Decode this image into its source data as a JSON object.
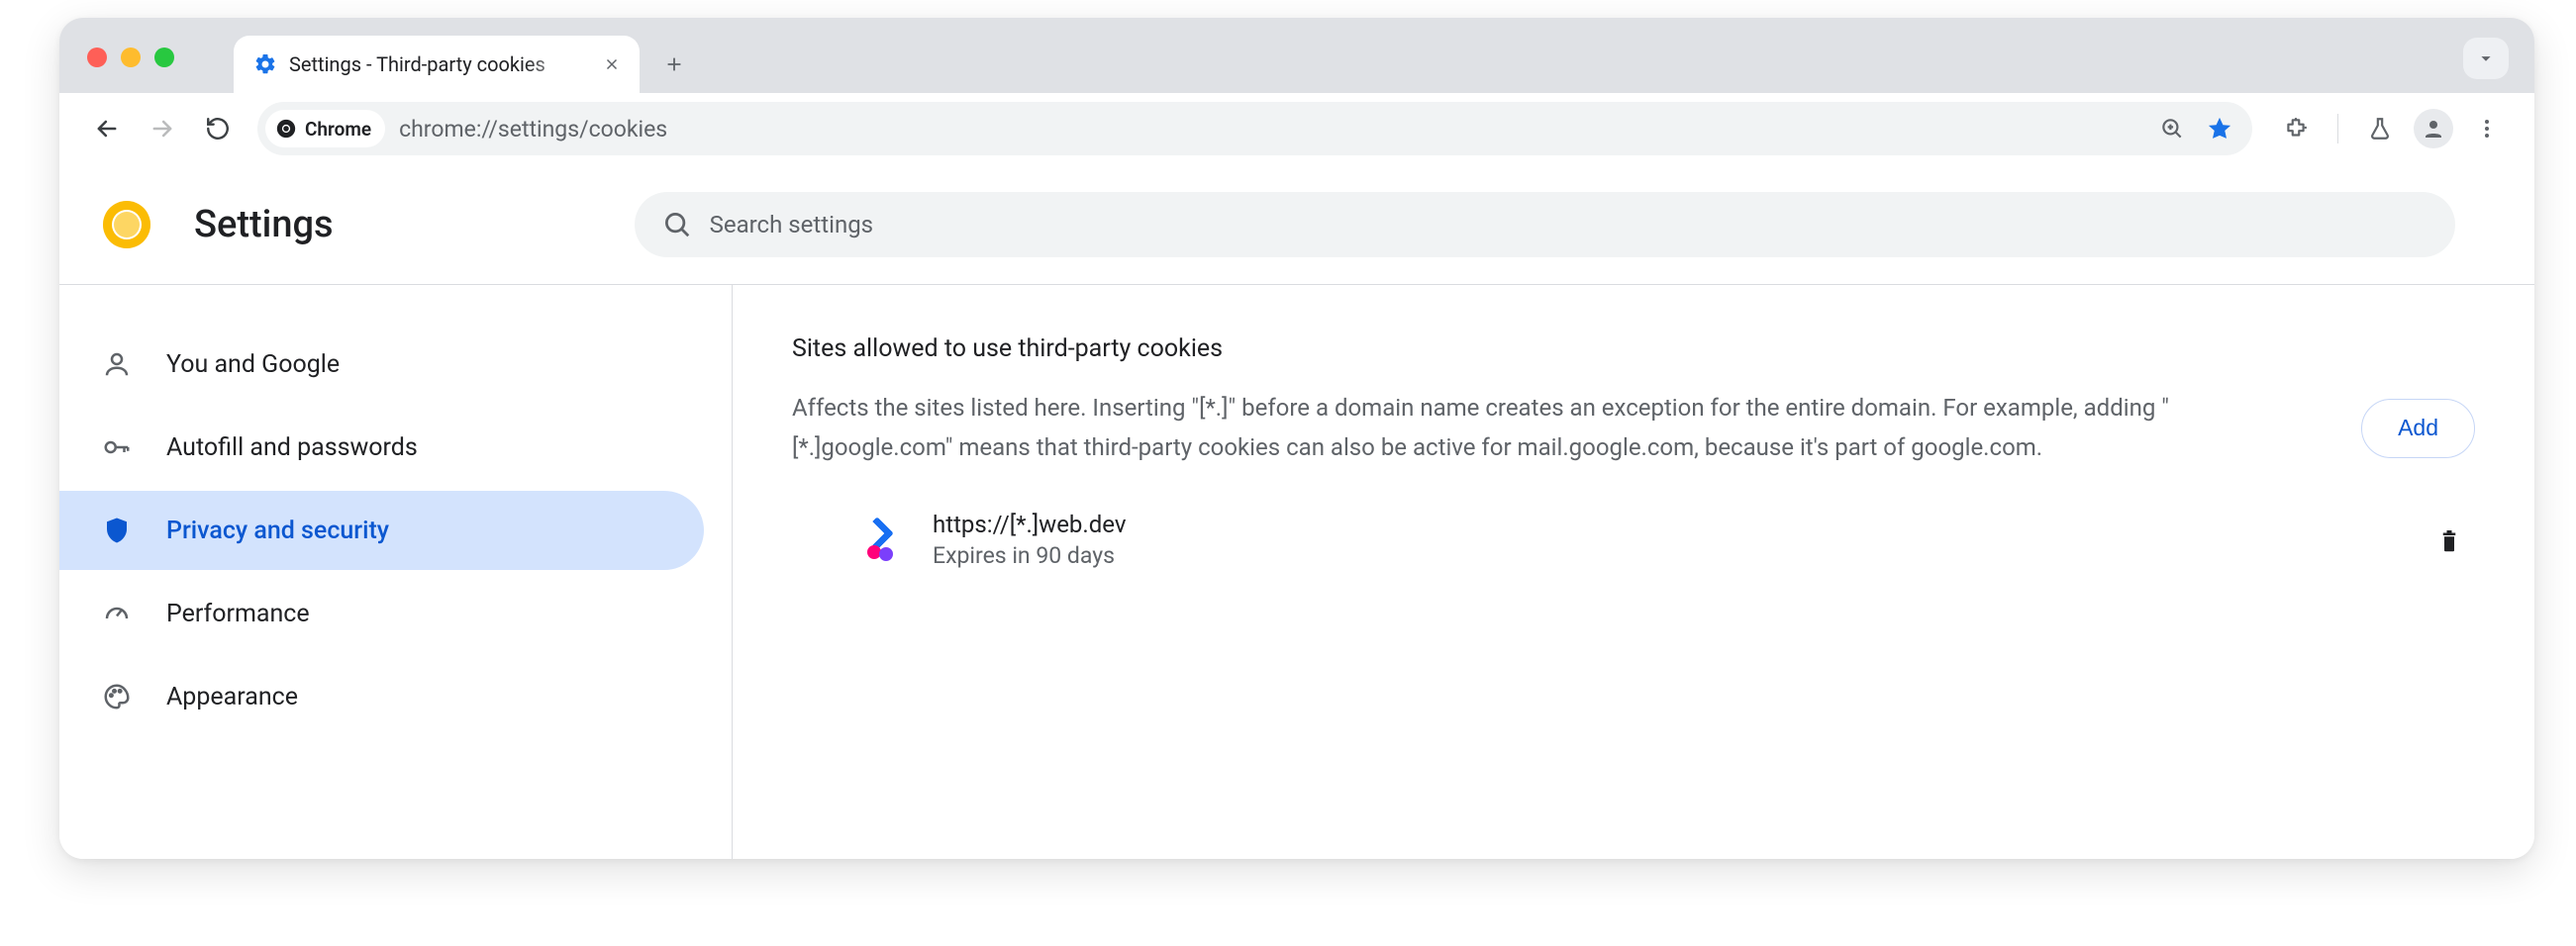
{
  "window": {
    "tab_title": "Settings - Third-party cookies",
    "url": "chrome://settings/cookies",
    "chrome_chip": "Chrome"
  },
  "header": {
    "title": "Settings",
    "search_placeholder": "Search settings"
  },
  "sidebar": {
    "items": [
      {
        "label": "You and Google"
      },
      {
        "label": "Autofill and passwords"
      },
      {
        "label": "Privacy and security"
      },
      {
        "label": "Performance"
      },
      {
        "label": "Appearance"
      }
    ],
    "active_index": 2
  },
  "main": {
    "section_title": "Sites allowed to use third-party cookies",
    "section_desc": "Affects the sites listed here. Inserting \"[*.]\" before a domain name creates an exception for the entire domain. For example, adding \"[*.]google.com\" means that third-party cookies can also be active for mail.google.com, because it's part of google.com.",
    "add_button": "Add",
    "entry": {
      "pattern": "https://[*.]web.dev",
      "expiry": "Expires in 90 days"
    }
  }
}
